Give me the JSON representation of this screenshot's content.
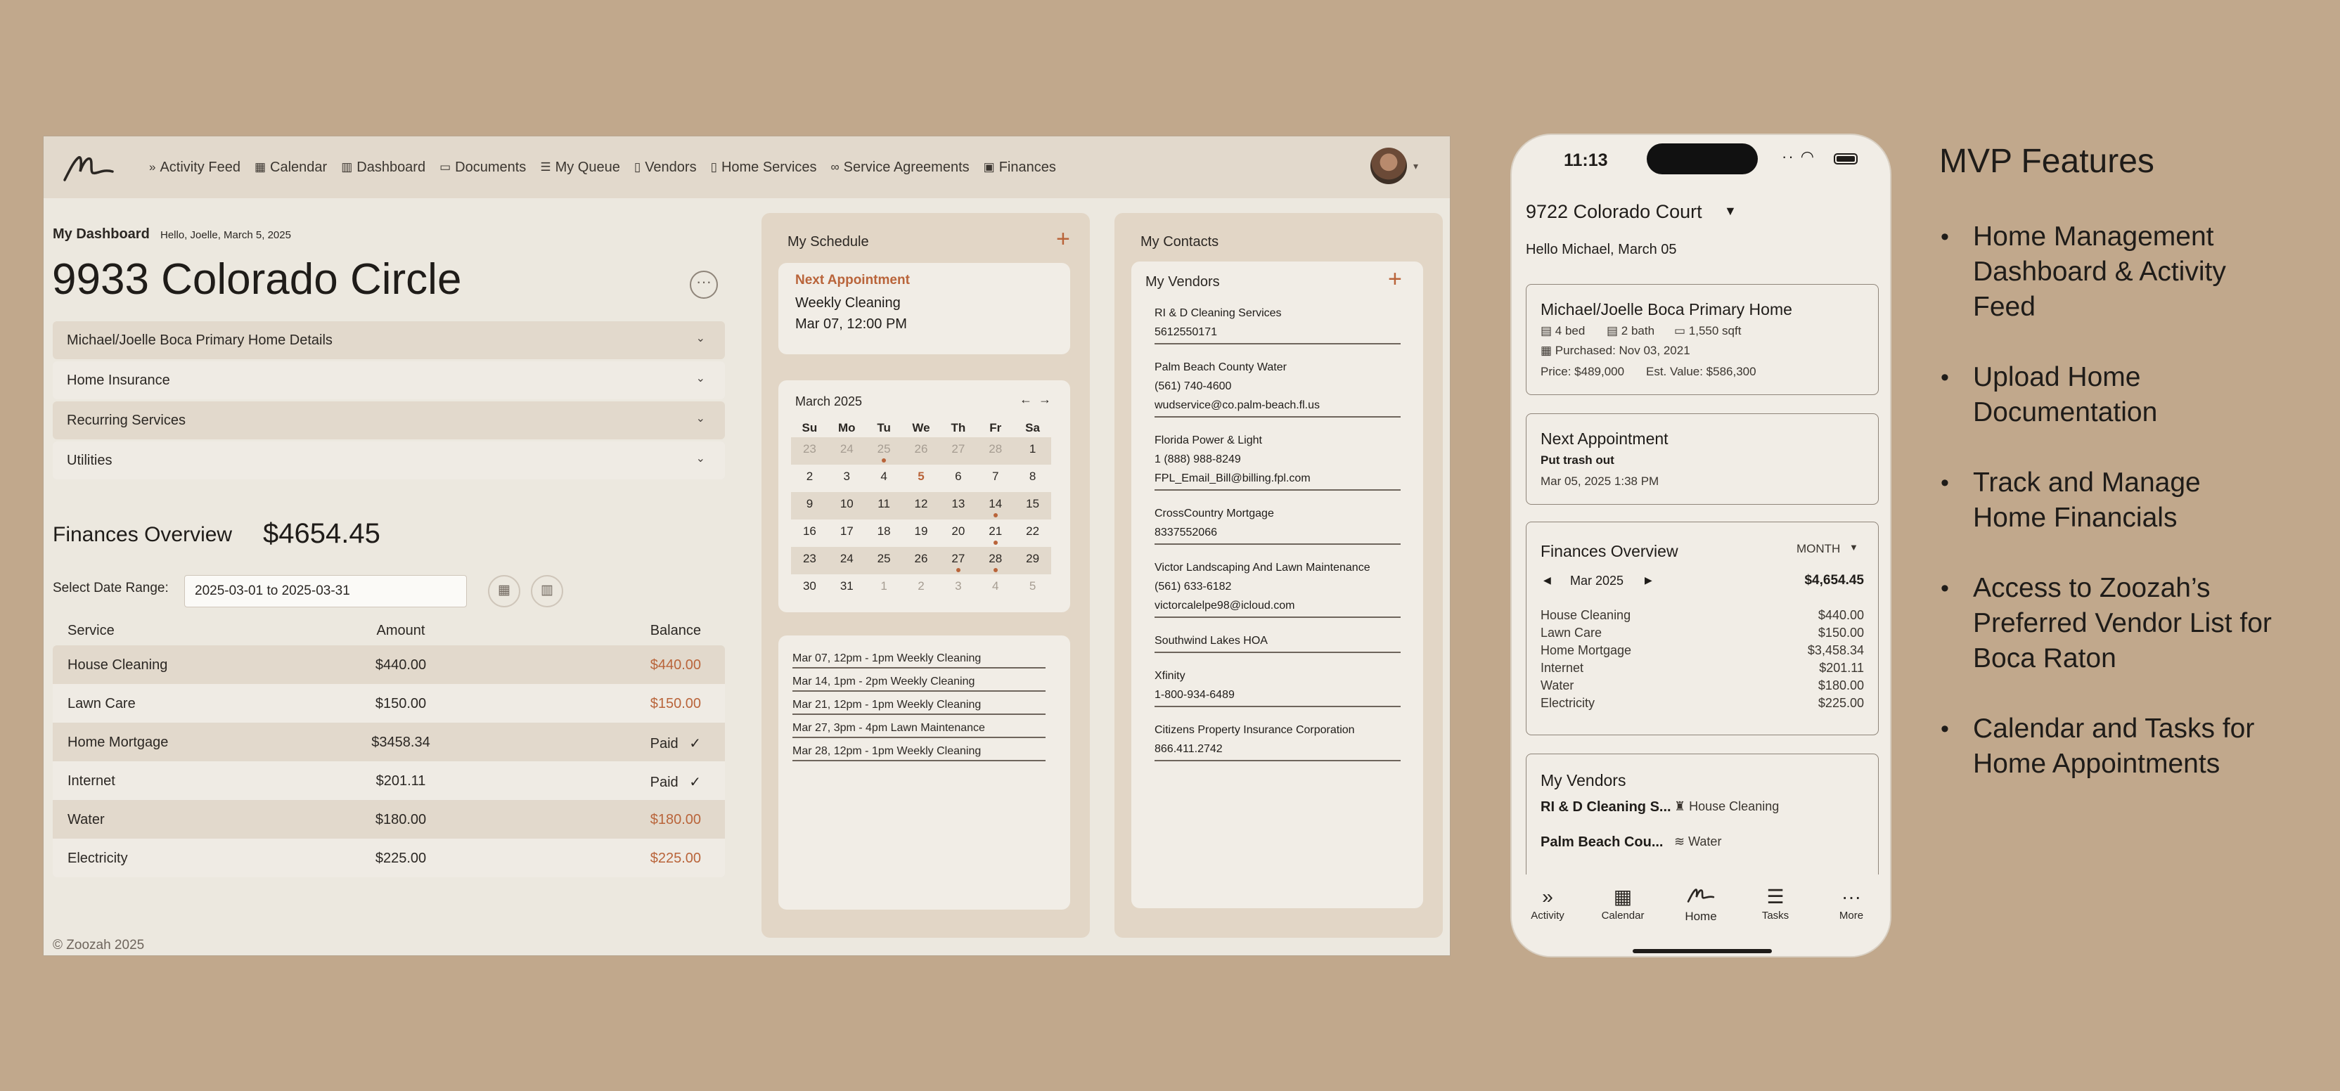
{
  "nav": {
    "items": [
      {
        "label": "Activity Feed",
        "icon": "chevrons-right-icon"
      },
      {
        "label": "Calendar",
        "icon": "calendar-icon"
      },
      {
        "label": "Dashboard",
        "icon": "bar-chart-icon"
      },
      {
        "label": "Documents",
        "icon": "folder-icon"
      },
      {
        "label": "My Queue",
        "icon": "list-icon"
      },
      {
        "label": "Vendors",
        "icon": "contact-book-icon"
      },
      {
        "label": "Home Services",
        "icon": "clipboard-icon"
      },
      {
        "label": "Service Agreements",
        "icon": "handshake-icon"
      },
      {
        "label": "Finances",
        "icon": "money-icon"
      }
    ]
  },
  "dashboard": {
    "title": "My Dashboard",
    "greeting": "Hello, Joelle, March 5, 2025",
    "address": "9933 Colorado Circle",
    "accordions": [
      "Michael/Joelle Boca Primary Home Details",
      "Home Insurance",
      "Recurring Services",
      "Utilities"
    ]
  },
  "finances": {
    "title": "Finances Overview",
    "total": "$4654.45",
    "range_label": "Select Date Range:",
    "range_value": "2025-03-01 to 2025-03-31",
    "columns": [
      "Service",
      "Amount",
      "Balance"
    ],
    "rows": [
      {
        "service": "House Cleaning",
        "amount": "$440.00",
        "balance": "$440.00",
        "paid": false
      },
      {
        "service": "Lawn Care",
        "amount": "$150.00",
        "balance": "$150.00",
        "paid": false
      },
      {
        "service": "Home Mortgage",
        "amount": "$3458.34",
        "balance": "Paid",
        "paid": true
      },
      {
        "service": "Internet",
        "amount": "$201.11",
        "balance": "Paid",
        "paid": true
      },
      {
        "service": "Water",
        "amount": "$180.00",
        "balance": "$180.00",
        "paid": false
      },
      {
        "service": "Electricity",
        "amount": "$225.00",
        "balance": "$225.00",
        "paid": false
      }
    ]
  },
  "footer": "© Zoozah 2025",
  "schedule": {
    "title": "My Schedule",
    "next_label": "Next Appointment",
    "next_name": "Weekly Cleaning",
    "next_time": "Mar 07, 12:00 PM",
    "calendar": {
      "month": "March 2025",
      "weekdays": [
        "Su",
        "Mo",
        "Tu",
        "We",
        "Th",
        "Fr",
        "Sa"
      ],
      "weeks": [
        [
          "23",
          "24",
          "25",
          "26",
          "27",
          "28",
          "1"
        ],
        [
          "2",
          "3",
          "4",
          "5",
          "6",
          "7",
          "8"
        ],
        [
          "9",
          "10",
          "11",
          "12",
          "13",
          "14",
          "15"
        ],
        [
          "16",
          "17",
          "18",
          "19",
          "20",
          "21",
          "22"
        ],
        [
          "23",
          "24",
          "25",
          "26",
          "27",
          "28",
          "29"
        ],
        [
          "30",
          "31",
          "1",
          "2",
          "3",
          "4",
          "5"
        ]
      ]
    },
    "list": [
      "Mar 07, 12pm - 1pm Weekly Cleaning",
      "Mar 14, 1pm - 2pm Weekly Cleaning",
      "Mar 21, 12pm - 1pm Weekly Cleaning",
      "Mar 27, 3pm - 4pm Lawn Maintenance",
      "Mar 28, 12pm - 1pm Weekly Cleaning"
    ]
  },
  "contacts": {
    "title": "My Contacts",
    "vendors_title": "My Vendors",
    "vendors": [
      [
        "RI & D Cleaning Services",
        "5612550171"
      ],
      [
        "Palm Beach County Water",
        "(561) 740-4600",
        "wudservice@co.palm-beach.fl.us"
      ],
      [
        "Florida Power & Light",
        "1 (888) 988-8249",
        "FPL_Email_Bill@billing.fpl.com"
      ],
      [
        "CrossCountry Mortgage",
        "8337552066"
      ],
      [
        "Victor Landscaping And Lawn Maintenance",
        "(561) 633-6182",
        "victorcalelpe98@icloud.com"
      ],
      [
        "Southwind Lakes HOA"
      ],
      [
        "Xfinity",
        "1-800-934-6489"
      ],
      [
        "Citizens Property Insurance Corporation",
        "866.411.2742"
      ]
    ]
  },
  "phone": {
    "time": "11:13",
    "address": "9722 Colorado Court",
    "hello": "Hello Michael, March 05",
    "home": {
      "title": "Michael/Joelle Boca Primary Home",
      "beds": "4 bed",
      "baths": "2 bath",
      "sqft": "1,550 sqft",
      "purchased": "Purchased: Nov 03, 2021",
      "price": "Price: $489,000",
      "value": "Est. Value: $586,300"
    },
    "next": {
      "title": "Next Appointment",
      "name": "Put trash out",
      "time": "Mar 05, 2025 1:38 PM"
    },
    "fin": {
      "title": "Finances Overview",
      "period": "MONTH",
      "month": "Mar 2025",
      "total": "$4,654.45",
      "rows": [
        [
          "House Cleaning",
          "$440.00"
        ],
        [
          "Lawn Care",
          "$150.00"
        ],
        [
          "Home Mortgage",
          "$3,458.34"
        ],
        [
          "Internet",
          "$201.11"
        ],
        [
          "Water",
          "$180.00"
        ],
        [
          "Electricity",
          "$225.00"
        ]
      ]
    },
    "vendors": {
      "title": "My Vendors",
      "rows": [
        [
          "RI & D Cleaning S...",
          "House Cleaning"
        ],
        [
          "Palm Beach Cou...",
          "Water"
        ]
      ]
    },
    "tabs": [
      "Activity",
      "Calendar",
      "Home",
      "Tasks",
      "More"
    ]
  },
  "features": {
    "title": "MVP Features",
    "items": [
      "Home Management Dashboard & Activity Feed",
      "Upload Home Documentation",
      "Track and Manage Home Financials",
      "Access to Zoozah’s Preferred Vendor List for Boca Raton",
      "Calendar and Tasks for Home Appointments"
    ]
  },
  "colors": {
    "accent": "#b9643a",
    "background": "#c1a88c",
    "panel": "#ece8df",
    "band": "#e2d9cc"
  }
}
